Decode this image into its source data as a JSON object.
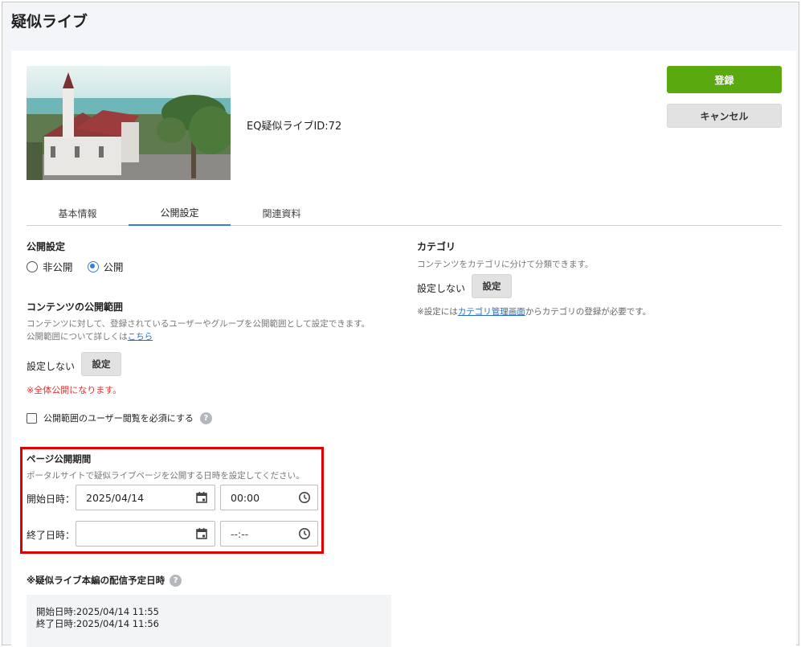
{
  "header": {
    "title": "疑似ライブ"
  },
  "content": {
    "live_id_label": "EQ疑似ライブID:72"
  },
  "actions": {
    "register_label": "登録",
    "cancel_label": "キャンセル"
  },
  "tabs": [
    {
      "label": "基本情報",
      "active": false
    },
    {
      "label": "公開設定",
      "active": true
    },
    {
      "label": "関連資料",
      "active": false
    }
  ],
  "publish": {
    "title": "公開設定",
    "options": [
      {
        "label": "非公開",
        "selected": false
      },
      {
        "label": "公開",
        "selected": true
      }
    ]
  },
  "scope": {
    "title": "コンテンツの公開範囲",
    "description": "コンテンツに対して、登録されているユーザーやグループを公開範囲として設定できます。",
    "details_prefix": "公開範囲について詳しくは",
    "details_link": "こちら",
    "status": "設定しない",
    "set_button": "設定",
    "warning": "※全体公開になります。",
    "require_view_label": "公開範囲のユーザー閲覧を必須にする"
  },
  "category": {
    "title": "カテゴリ",
    "description": "コンテンツをカテゴリに分けて分類できます。",
    "status": "設定しない",
    "set_button": "設定",
    "note_prefix": "※設定には",
    "note_link": "カテゴリ管理画面",
    "note_suffix": "からカテゴリの登録が必要です。"
  },
  "period": {
    "title": "ページ公開期間",
    "description": "ポータルサイトで疑似ライブページを公開する日時を設定してください。",
    "start_label": "開始日時：",
    "start_date": "2025/04/14",
    "start_time": "00:00",
    "end_label": "終了日時：",
    "end_date": "",
    "end_time_placeholder": "--:--"
  },
  "schedule": {
    "title": "※疑似ライブ本編の配信予定日時",
    "start": "開始日時:2025/04/14 11:55",
    "end": "終了日時:2025/04/14 11:56"
  },
  "icons": {
    "calendar": "calendar-icon",
    "clock": "clock-icon",
    "help": "help-icon"
  },
  "colors": {
    "primary_button": "#5aaa0f",
    "accent": "#3b7dd8",
    "warning": "#e53030",
    "highlight_border": "#e00000"
  }
}
